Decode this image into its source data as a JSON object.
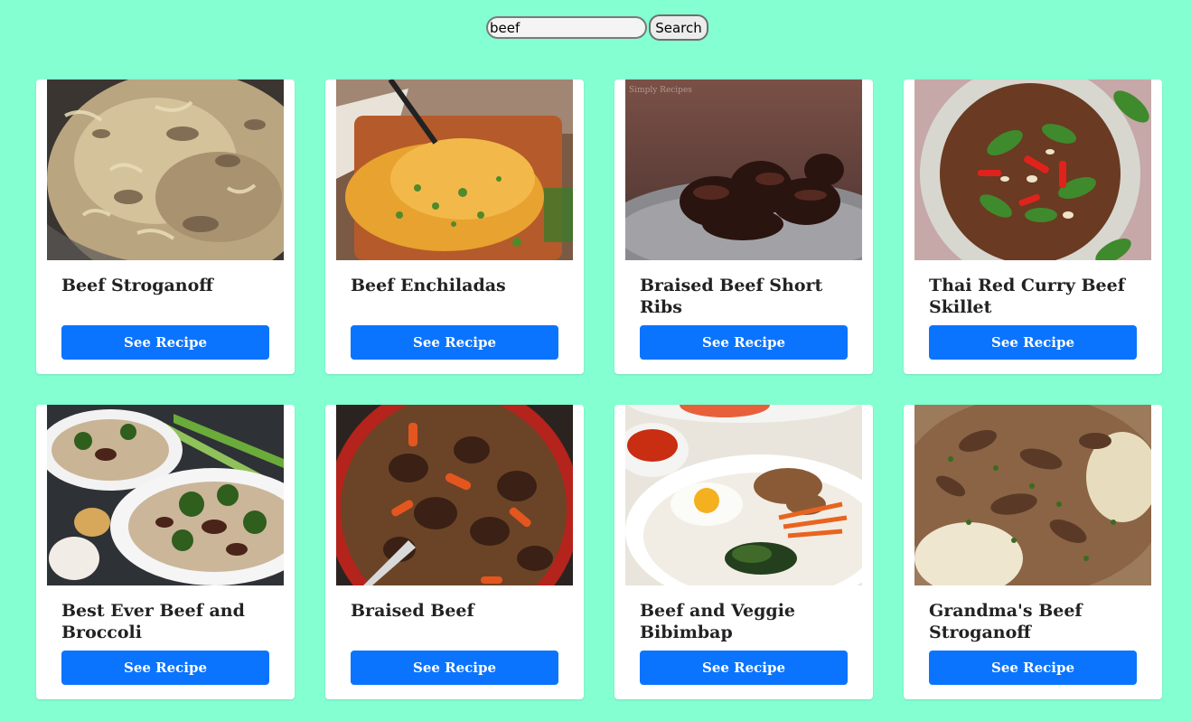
{
  "search": {
    "value": "beef",
    "button_label": "Search"
  },
  "recipes": [
    {
      "title": "Beef Stroganoff",
      "button_label": "See Recipe"
    },
    {
      "title": "Beef Enchiladas",
      "button_label": "See Recipe"
    },
    {
      "title": "Braised Beef Short Ribs",
      "button_label": "See Recipe",
      "watermark": "Simply Recipes"
    },
    {
      "title": "Thai Red Curry Beef Skillet",
      "button_label": "See Recipe"
    },
    {
      "title": "Best Ever Beef and Broccoli",
      "button_label": "See Recipe"
    },
    {
      "title": "Braised Beef",
      "button_label": "See Recipe"
    },
    {
      "title": "Beef and Veggie Bibimbap",
      "button_label": "See Recipe"
    },
    {
      "title": "Grandma's Beef Stroganoff",
      "button_label": "See Recipe"
    }
  ],
  "colors": {
    "page_background": "#84FFD2",
    "button_background": "#0A74FF",
    "card_background": "#FFFFFF"
  }
}
